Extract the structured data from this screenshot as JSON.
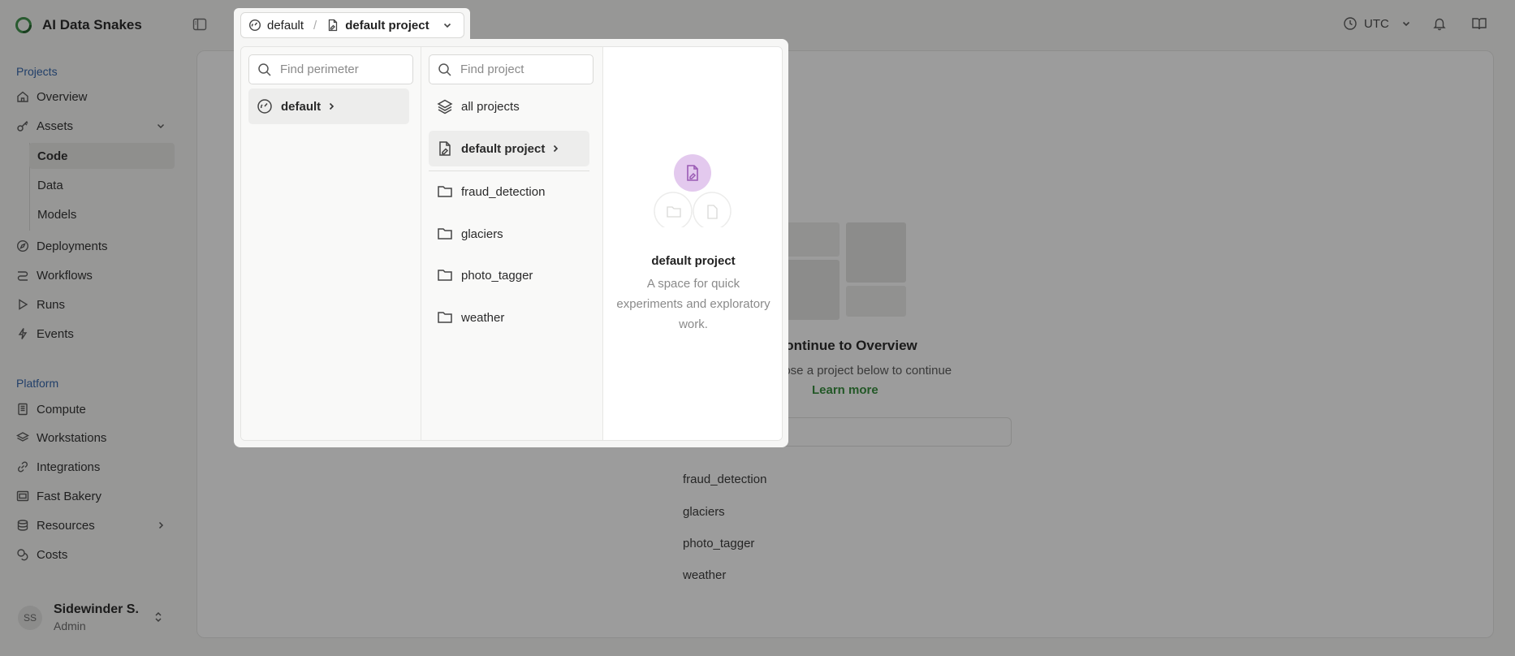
{
  "app": {
    "name": "AI Data Snakes"
  },
  "sidebar": {
    "projects_label": "Projects",
    "platform_label": "Platform",
    "items": {
      "overview": "Overview",
      "assets": "Assets",
      "code": "Code",
      "data": "Data",
      "models": "Models",
      "deployments": "Deployments",
      "workflows": "Workflows",
      "runs": "Runs",
      "events": "Events",
      "compute": "Compute",
      "workstations": "Workstations",
      "integrations": "Integrations",
      "fast_bakery": "Fast Bakery",
      "resources": "Resources",
      "costs": "Costs"
    },
    "user": {
      "initials": "SS",
      "name": "Sidewinder S.",
      "role": "Admin"
    }
  },
  "topbar": {
    "timezone": "UTC"
  },
  "main": {
    "title": "Continue to Overview",
    "subtitle": "oose a project below to continue",
    "learn_more": "Learn more",
    "projects": [
      "fraud_detection",
      "glaciers",
      "photo_tagger",
      "weather"
    ]
  },
  "breadcrumb": {
    "perimeter": "default",
    "separator": "/",
    "project": "default project"
  },
  "popover": {
    "perimeter_search_placeholder": "Find perimeter",
    "project_search_placeholder": "Find project",
    "perimeters": [
      {
        "label": "default",
        "icon": "gauge-icon"
      }
    ],
    "all_projects": "all projects",
    "selected_project": "default project",
    "projects": [
      "fraud_detection",
      "glaciers",
      "photo_tagger",
      "weather"
    ],
    "detail": {
      "title": "default project",
      "description": "A space for quick experiments and exploratory work."
    }
  },
  "colors": {
    "accent_green": "#2f8a36",
    "accent_purple": "#e3c9ee",
    "section_label": "#2b5fa8"
  }
}
